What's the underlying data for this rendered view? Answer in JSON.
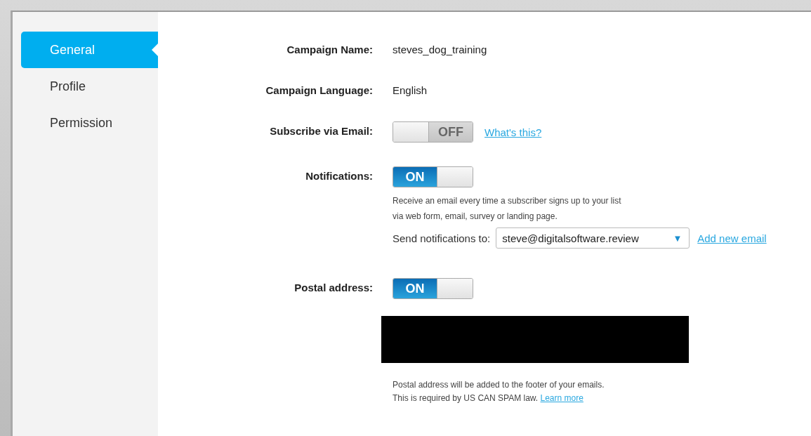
{
  "sidebar": {
    "items": [
      {
        "label": "General",
        "selected": true
      },
      {
        "label": "Profile",
        "selected": false
      },
      {
        "label": "Permission",
        "selected": false
      }
    ]
  },
  "form": {
    "campaign_name": {
      "label": "Campaign Name:",
      "value": "steves_dog_training"
    },
    "campaign_language": {
      "label": "Campaign Language:",
      "value": "English"
    },
    "subscribe_via_email": {
      "label": "Subscribe via Email:",
      "on": false,
      "toggle_text": "OFF",
      "link": "What's this?"
    },
    "notifications": {
      "label": "Notifications:",
      "on": true,
      "toggle_text": "ON",
      "description": [
        "Receive an email every time a subscriber signs up to your list",
        "via web form, email, survey or landing page."
      ],
      "send_to_label": "Send notifications to:",
      "send_to_value": "steve@digitalsoftware.review",
      "dropdown_arrow": "▼",
      "add_link": "Add new email"
    },
    "postal_address": {
      "label": "Postal address:",
      "on": true,
      "toggle_text": "ON",
      "redacted": true,
      "note": [
        "Postal address will be added to the footer of your emails.",
        "This is required by US CAN SPAM law."
      ],
      "note_link": "Learn more"
    }
  }
}
